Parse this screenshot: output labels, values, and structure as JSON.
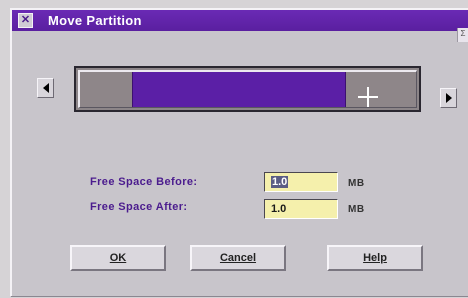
{
  "window": {
    "title": "Move Partition",
    "sysmenu_glyph": "✕",
    "corner_glyph": "Σ"
  },
  "slider": {
    "left_arrow_icon": "left-triangle-icon",
    "right_arrow_icon": "right-triangle-icon",
    "handle_icon": "move-crosshair-icon",
    "colors": {
      "free_space": "#8e8689",
      "partition": "#5b1fa6"
    }
  },
  "fields": {
    "free_before": {
      "label": "Free Space Before:",
      "value": "1.0",
      "unit": "MB"
    },
    "free_after": {
      "label": "Free Space After:",
      "value": "1.0",
      "unit": "MB"
    }
  },
  "buttons": {
    "ok": "OK",
    "cancel": "Cancel",
    "help": "Help"
  }
}
